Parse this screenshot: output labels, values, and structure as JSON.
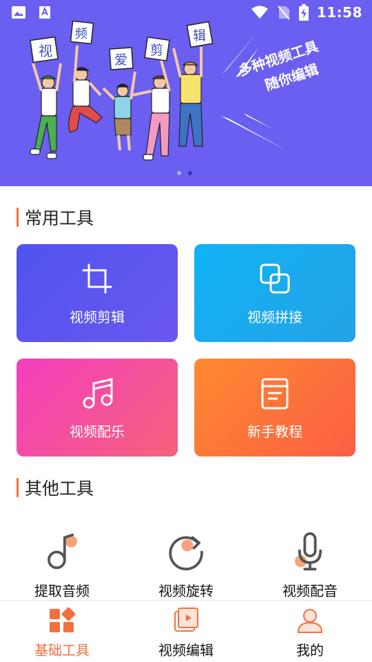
{
  "status_bar": {
    "time": "11:58"
  },
  "banner": {
    "tagline_line1": "多种视频工具",
    "tagline_line2": "随你编辑",
    "sign_chars": [
      "视",
      "频",
      "爱",
      "剪",
      "辑"
    ],
    "page_count": 2,
    "active_page": 2,
    "background_color": "#6a5ff0"
  },
  "common_tools": {
    "title": "常用工具",
    "items": [
      {
        "label": "视频剪辑",
        "icon": "crop-icon"
      },
      {
        "label": "视频拼接",
        "icon": "overlap-squares-icon"
      },
      {
        "label": "视频配乐",
        "icon": "music-note-icon"
      },
      {
        "label": "新手教程",
        "icon": "document-icon"
      }
    ]
  },
  "other_tools": {
    "title": "其他工具",
    "items": [
      {
        "label": "提取音频",
        "icon": "audio-note-icon"
      },
      {
        "label": "视频旋转",
        "icon": "rotate-icon"
      },
      {
        "label": "视频配音",
        "icon": "microphone-icon"
      }
    ]
  },
  "bottom_nav": {
    "items": [
      {
        "label": "基础工具",
        "icon": "grid-tools-icon",
        "active": true
      },
      {
        "label": "视频编辑",
        "icon": "video-edit-icon",
        "active": false
      },
      {
        "label": "我的",
        "icon": "user-icon",
        "active": false
      }
    ]
  },
  "colors": {
    "accent": "#f4703e",
    "banner": "#6a5ff0"
  }
}
